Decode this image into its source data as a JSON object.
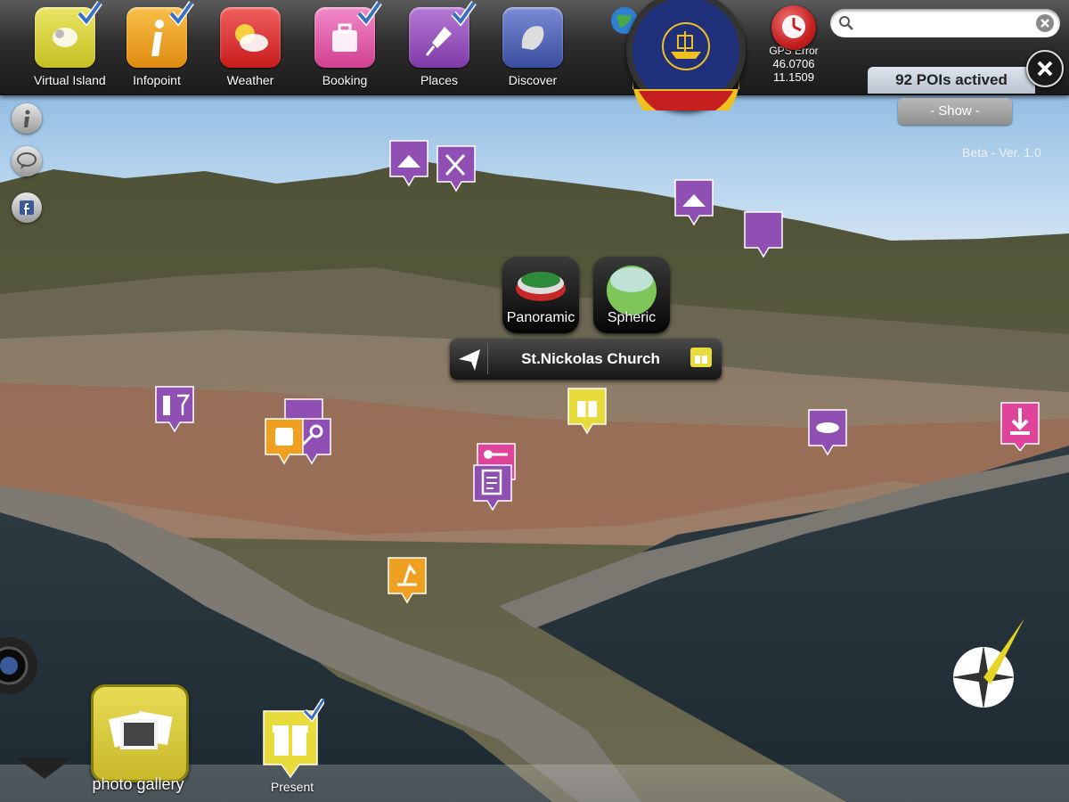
{
  "toolbar": {
    "buttons": [
      {
        "label": "Virtual Island",
        "checked": true,
        "color": "#d9d43a",
        "icon": "puzzle-icon"
      },
      {
        "label": "Infopoint",
        "checked": true,
        "color": "#f0a021",
        "icon": "info-icon"
      },
      {
        "label": "Weather",
        "checked": false,
        "color": "#e03a3a",
        "icon": "cloud-icon"
      },
      {
        "label": "Booking",
        "checked": true,
        "color": "#e45aa8",
        "icon": "suitcase-icon"
      },
      {
        "label": "Places",
        "checked": true,
        "color": "#9655bb",
        "icon": "pin-icon"
      },
      {
        "label": "Discover",
        "checked": false,
        "color": "#4b5fb5",
        "icon": "discover-icon"
      }
    ]
  },
  "gps": {
    "label": "GPS Error",
    "lat": "46.0706",
    "lon": "11.1509"
  },
  "search": {
    "value": "",
    "placeholder": ""
  },
  "pois": {
    "count_label": "92 POIs actived",
    "show_label": "- Show -"
  },
  "version": "Beta - Ver. 1.0",
  "poi_popup": {
    "title": "St.Nickolas Church",
    "panoramic_label": "Panoramic",
    "spheric_label": "Spheric"
  },
  "bottom": {
    "gallery_label": "photo gallery",
    "present_label": "Present"
  },
  "colors": {
    "places": "#8f4fb3",
    "infopoint": "#f0a021",
    "present": "#e8dc3c",
    "booking": "#e0449a"
  }
}
